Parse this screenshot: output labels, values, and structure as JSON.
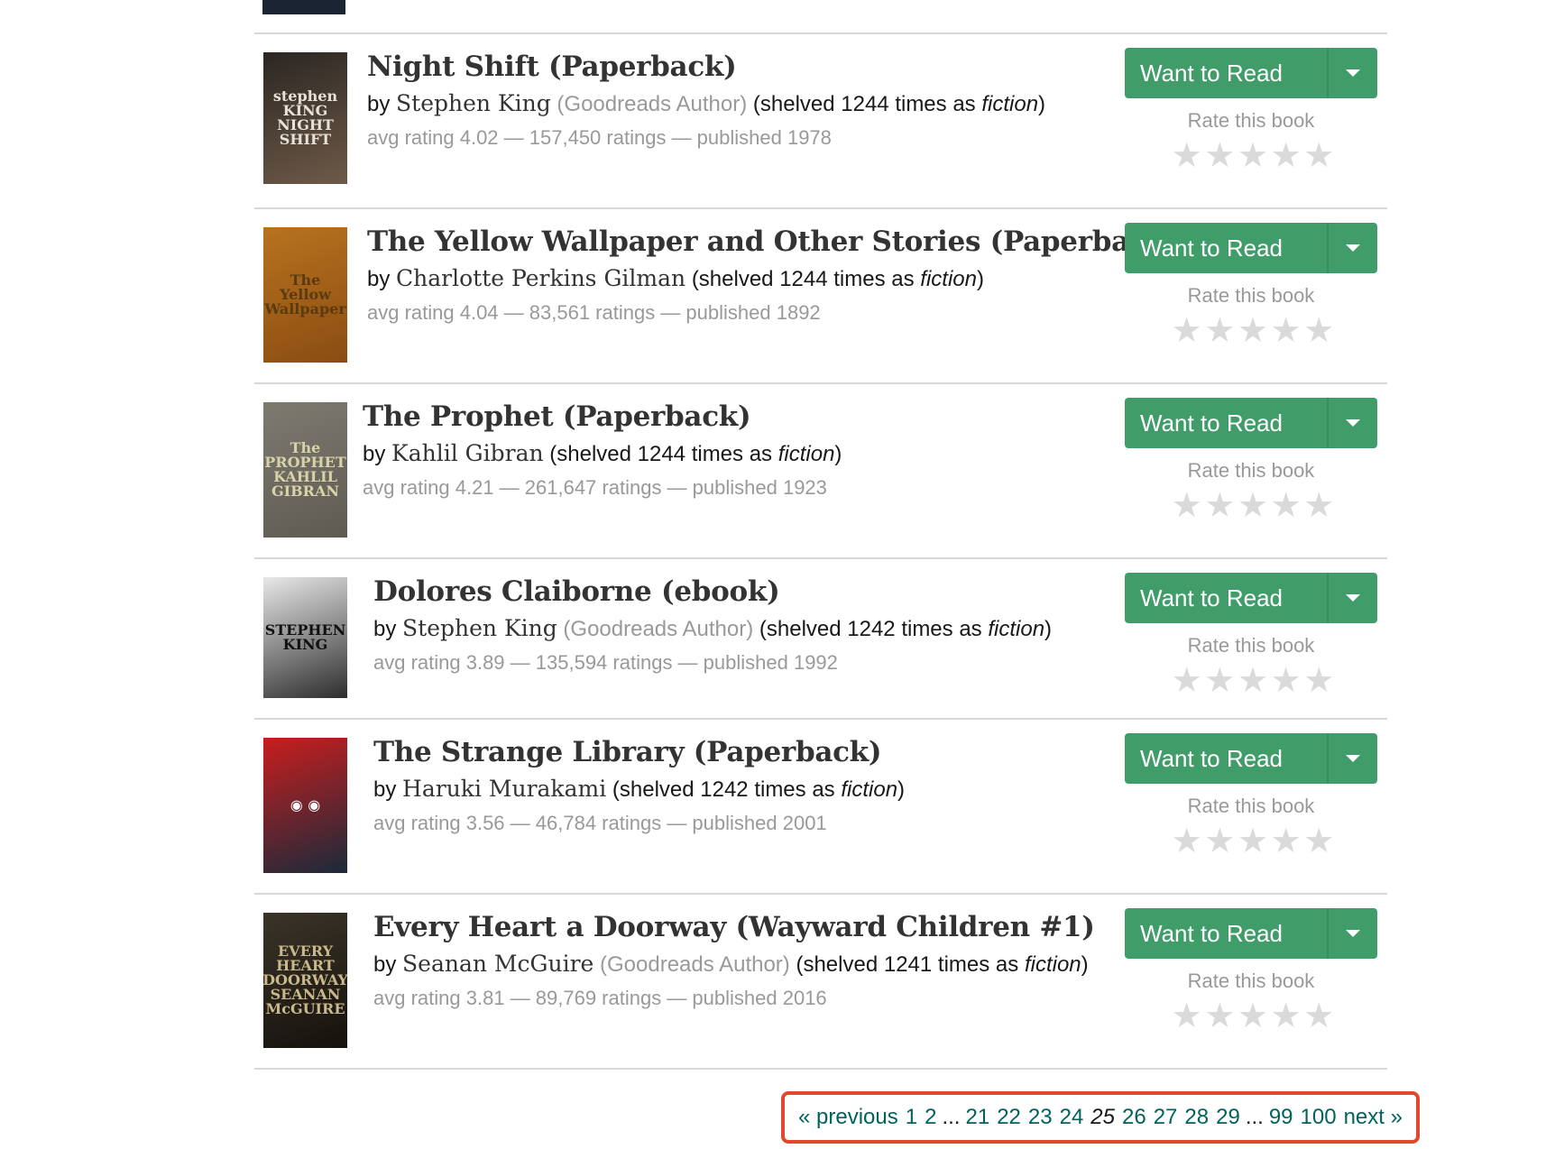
{
  "books": [
    {
      "title": "Night Shift (Paperback)",
      "by": "by",
      "author": "Stephen King",
      "goodreads_author": "(Goodreads Author)",
      "shelved_pre": "(shelved 1244 times as",
      "shelved_genre": "fiction",
      "shelved_post": ")",
      "meta": "avg rating 4.02 — 157,450 ratings — published 1978",
      "cover_text": "stephen KING NIGHT SHIFT",
      "cover_colors": [
        "#2b2622",
        "#6e5a48"
      ],
      "cover_text_color": "#e8e2d6"
    },
    {
      "title": "The Yellow Wallpaper and Other Stories (Paperback)",
      "by": "by",
      "author": "Charlotte Perkins Gilman",
      "goodreads_author": "",
      "shelved_pre": "(shelved 1244 times as",
      "shelved_genre": "fiction",
      "shelved_post": ")",
      "meta": "avg rating 4.04 — 83,561 ratings — published 1892",
      "cover_text": "The Yellow Wallpaper",
      "cover_colors": [
        "#b8721f",
        "#8a4d12"
      ],
      "cover_text_color": "#5a3a10"
    },
    {
      "title": "The Prophet (Paperback)",
      "by": "by",
      "author": "Kahlil Gibran",
      "goodreads_author": "",
      "shelved_pre": "(shelved 1244 times as",
      "shelved_genre": "fiction",
      "shelved_post": ")",
      "meta": "avg rating 4.21 — 261,647 ratings — published 1923",
      "cover_text": "The PROPHET KAHLIL GIBRAN",
      "cover_colors": [
        "#7d7a70",
        "#5e5b52"
      ],
      "cover_text_color": "#d9d2a8"
    },
    {
      "title": "Dolores Claiborne (ebook)",
      "by": "by",
      "author": "Stephen King",
      "goodreads_author": "(Goodreads Author)",
      "shelved_pre": "(shelved 1242 times as",
      "shelved_genre": "fiction",
      "shelved_post": ")",
      "meta": "avg rating 3.89 — 135,594 ratings — published 1992",
      "cover_text": "STEPHEN KING",
      "cover_colors": [
        "#e8e8e8",
        "#2d2d2d"
      ],
      "cover_text_color": "#111111"
    },
    {
      "title": "The Strange Library (Paperback)",
      "by": "by",
      "author": "Haruki Murakami",
      "goodreads_author": "",
      "shelved_pre": "(shelved 1242 times as",
      "shelved_genre": "fiction",
      "shelved_post": ")",
      "meta": "avg rating 3.56 — 46,784 ratings — published 2001",
      "cover_text": "◉ ◉",
      "cover_colors": [
        "#c81e1e",
        "#1b2a3a"
      ],
      "cover_text_color": "#ffffff"
    },
    {
      "title": "Every Heart a Doorway (Wayward Children #1)",
      "by": "by",
      "author": "Seanan McGuire",
      "goodreads_author": "(Goodreads Author)",
      "shelved_pre": "(shelved 1241 times as",
      "shelved_genre": "fiction",
      "shelved_post": ")",
      "meta": "avg rating 3.81 — 89,769 ratings — published 2016",
      "cover_text": "EVERY HEART DOORWAY SEANAN McGUIRE",
      "cover_colors": [
        "#3a3428",
        "#15120d"
      ],
      "cover_text_color": "#c9b88a"
    }
  ],
  "shelf_button": {
    "label": "Want to Read"
  },
  "rate_label": "Rate this book",
  "star_glyph": "★",
  "pagination": {
    "previous": "« previous",
    "next": "next »",
    "gap": "...",
    "current": "25",
    "pages_before_gap": [
      "1",
      "2"
    ],
    "pages_middle_before": [
      "21",
      "22",
      "23",
      "24"
    ],
    "pages_middle_after": [
      "26",
      "27",
      "28",
      "29"
    ],
    "pages_end": [
      "99",
      "100"
    ]
  },
  "colors": {
    "button_green": "#409d69",
    "link_teal": "#00635d",
    "highlight_red": "#e0492f"
  }
}
